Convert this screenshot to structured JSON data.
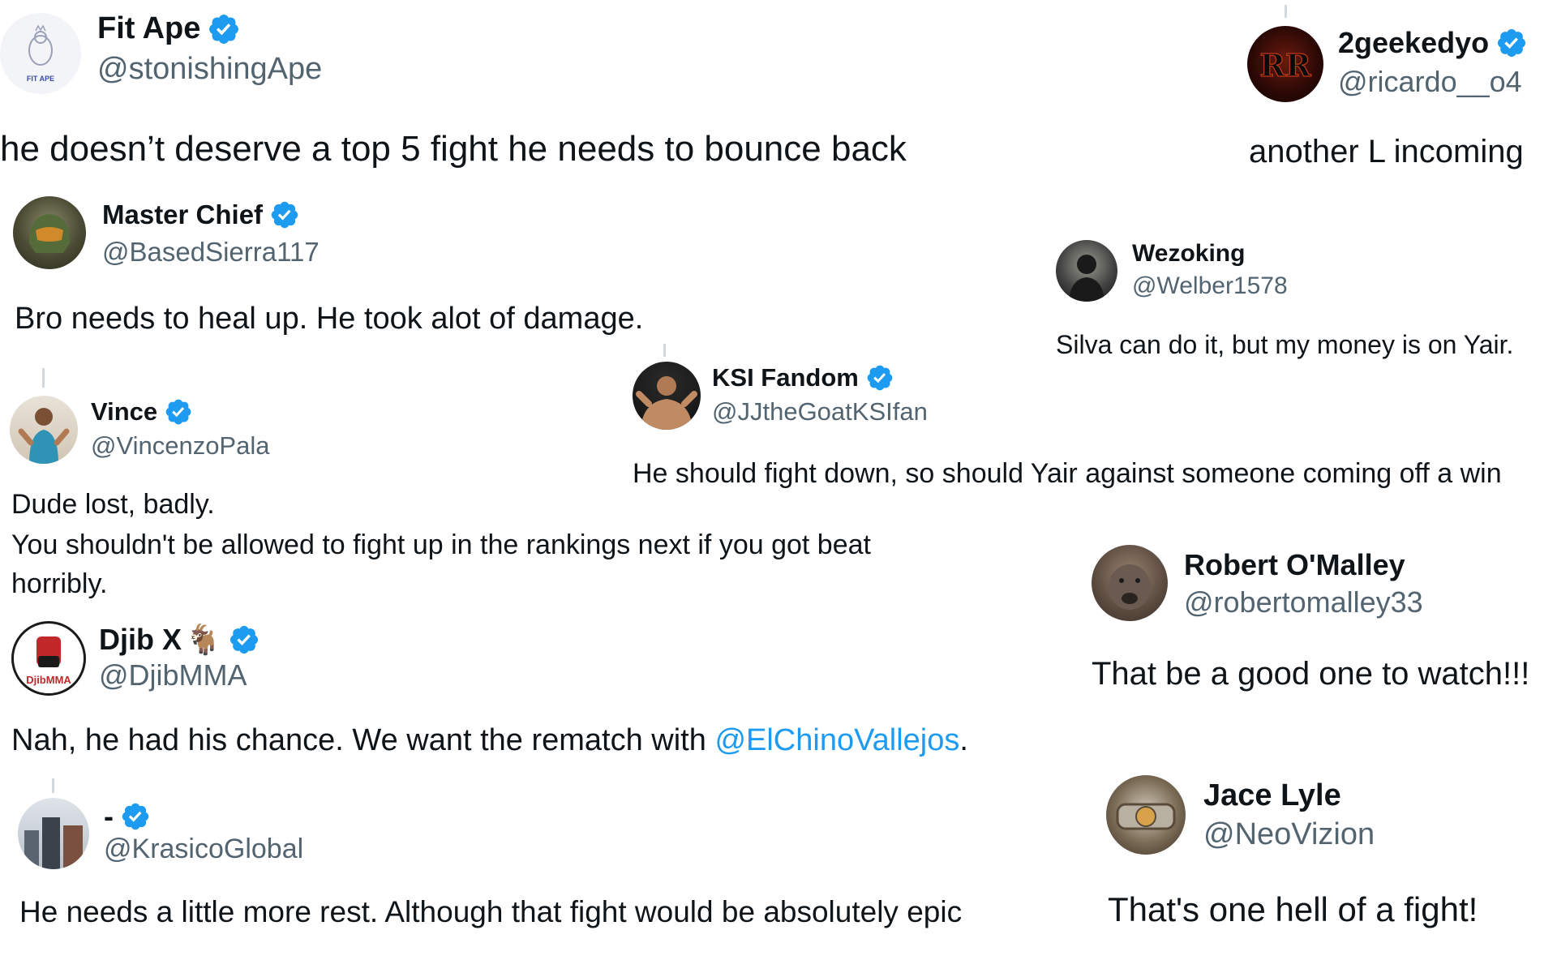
{
  "colors": {
    "verified": "#1d9bf0",
    "mention": "#1d9bf0",
    "handle": "#536471",
    "text": "#0f1419"
  },
  "tweets": [
    {
      "name": "Fit Ape",
      "handle": "@stonishingApe",
      "verified": true,
      "avatar_icon": "gorilla-logo-icon",
      "avatar_caption": "FIT APE",
      "text": "he doesn’t deserve a top 5 fight he needs to bounce back"
    },
    {
      "name": "2geekedyo",
      "handle": "@ricardo__o4",
      "verified": true,
      "avatar_icon": "rr-logo-icon",
      "avatar_caption": "RR",
      "text": "another L incoming"
    },
    {
      "name": "Master Chief",
      "handle": "@BasedSierra117",
      "verified": true,
      "avatar_icon": "helmet-avatar-icon",
      "text": "Bro needs to heal up. He took alot of damage."
    },
    {
      "name": "Wezoking",
      "handle": "@Welber1578",
      "verified": false,
      "avatar_icon": "portrait-avatar-icon",
      "text": "Silva can do it,  but my money is on Yair."
    },
    {
      "name": "KSI Fandom",
      "handle": "@JJtheGoatKSIfan",
      "verified": true,
      "avatar_icon": "fighter-avatar-icon",
      "text": "He should fight down, so should Yair against someone coming off a win"
    },
    {
      "name": "Vince",
      "handle": "@VincenzoPala",
      "verified": true,
      "avatar_icon": "person-avatar-icon",
      "text": "Dude lost, badly.",
      "text2": "You shouldn't be allowed to fight up in the rankings next if you got beat horribly."
    },
    {
      "name": "Robert O'Malley",
      "handle": "@robertomalley33",
      "verified": false,
      "avatar_icon": "dog-avatar-icon",
      "text": "That be a good one to watch!!!"
    },
    {
      "name": "Djib X",
      "name_emoji": "🐐",
      "handle": "@DjibMMA",
      "verified": true,
      "avatar_icon": "fist-logo-icon",
      "avatar_caption": "DjibMMA",
      "text_before": "Nah, he had his chance. We want the rematch with ",
      "mention": "@ElChinoVallejos",
      "text_after": "."
    },
    {
      "name": "Jace Lyle",
      "handle": "@NeoVizion",
      "verified": false,
      "avatar_icon": "belt-avatar-icon",
      "text": "That's one hell of a fight!"
    },
    {
      "name": "-",
      "handle": "@KrasicoGlobal",
      "verified": true,
      "avatar_icon": "city-avatar-icon",
      "text": "He needs a little more rest. Although that fight would be absolutely epic"
    }
  ]
}
